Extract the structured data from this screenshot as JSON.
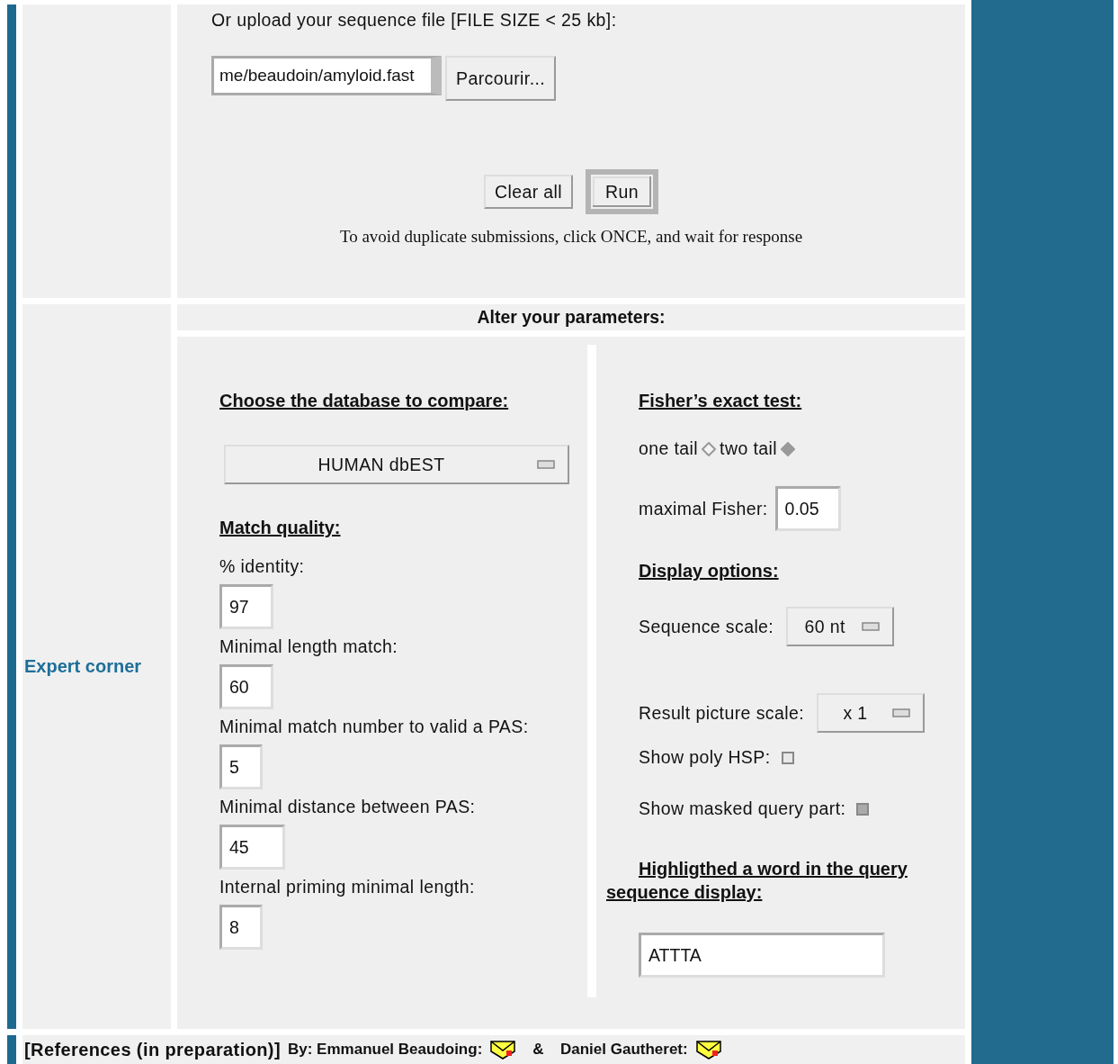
{
  "upload": {
    "label": "Or upload your sequence file [FILE SIZE < 25 kb]:",
    "file_value": "me/beaudoin/amyloid.fast",
    "browse_button": "Parcourir..."
  },
  "actions": {
    "buttons": [
      {
        "label": "Clear all",
        "selected": false
      },
      {
        "label": "Run",
        "selected": true
      }
    ],
    "note": "To avoid duplicate submissions, click ONCE, and wait for response"
  },
  "sidebar_label": "Expert corner",
  "section_title": "Alter your parameters:",
  "left": {
    "database": {
      "heading": "Choose the database to compare:",
      "select": "HUMAN dbEST"
    },
    "match_quality": {
      "heading": "Match quality:",
      "fields": [
        {
          "label": "% identity:",
          "value": "97"
        },
        {
          "label": "Minimal length match:",
          "value": "60"
        },
        {
          "label": "Minimal match number to valid a PAS:",
          "value": "5"
        },
        {
          "label": "Minimal distance between PAS:",
          "value": "45"
        },
        {
          "label": "Internal priming minimal length:",
          "value": "8"
        }
      ]
    }
  },
  "right": {
    "fisher": {
      "heading": "Fisher’s exact test:",
      "options": [
        {
          "label": "one tail",
          "selected": false
        },
        {
          "label": "two tail",
          "selected": true
        }
      ],
      "max_label": "maximal Fisher:",
      "max_value": "0.05"
    },
    "display": {
      "heading": "Display options:",
      "selects": [
        {
          "label": "Sequence scale:",
          "value": "60 nt"
        },
        {
          "label": "Result picture scale:",
          "value": "x 1"
        }
      ],
      "checkboxes": [
        {
          "label": "Show poly HSP:",
          "checked": false
        },
        {
          "label": "Show masked query part:",
          "checked": true
        }
      ]
    },
    "highlight": {
      "heading": "Highligthed a word in the query sequence display:",
      "value": "ATTTA"
    }
  },
  "footer": {
    "references": "[References (in preparation)]",
    "by": "By: Emmanuel Beaudoing:",
    "separator": "&",
    "second": "Daniel Gautheret:"
  }
}
